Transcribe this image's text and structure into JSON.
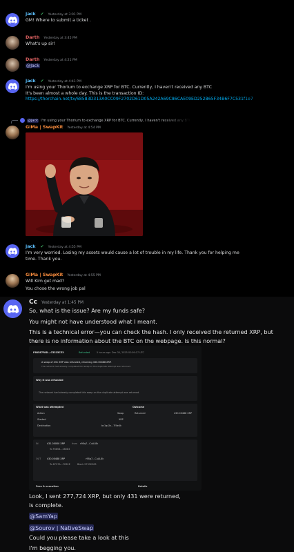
{
  "messages": {
    "m1": {
      "author": "jack",
      "timestamp": "Yesterday at 3:01 PM",
      "text": "GM!  Where to submit a ticket ."
    },
    "m2": {
      "author": "Darth",
      "timestamp": "Yesterday at 3:45 PM",
      "text": "What's up sir!"
    },
    "m3": {
      "author": "Darth",
      "timestamp": "Yesterday at 4:21 PM",
      "mention": "@Jack"
    },
    "m4": {
      "author": "jack",
      "timestamp": "Yesterday at 4:41 PM",
      "line1": "I'm using your Thorium to exchange XRP for BTC. Currently, I haven't received any BTC",
      "line2": "It's been almost a whole day. This is the transaction ID:",
      "link": "https://thorchain.net/tx/68583D313A0CC09F2702D61D05A242A69C86CAE09ED252B65F34B6F7C531f1e7"
    },
    "m5": {
      "reply_author": "@jack",
      "reply_text": "I'm using your Thorium to exchange XRP for BTC. Currently, I haven't received any BTC",
      "author": "GiMa | SwapKit",
      "timestamp": "Yesterday at 4:54 PM"
    },
    "m6": {
      "author": "jack",
      "timestamp": "Yesterday at 4:55 PM",
      "line1": "I'm very worried. Losing my assets would cause a lot of trouble in my life. Thank you for helping me",
      "line2": "time. Thank you."
    },
    "m7": {
      "author": "GiMa | SwapKit",
      "timestamp": "Yesterday at 4:55 PM",
      "line1": "Will Kim get mad?",
      "line2": "You chose the wrong job pal"
    },
    "m8": {
      "author": "Cc",
      "timestamp": "Yesterday at 1:45 PM",
      "lines": [
        "So, what is the issue? Are my funds safe?",
        "You might not have understood what I meant.",
        "This is a technical error—you can check the hash. I only received the returned XRP, but",
        "there is no information about the BTC on the webpage. Is this normal?"
      ],
      "after": [
        "Look, I sent 277,724 XRP, but only 431 were returned, ",
        "is complete."
      ],
      "mentions": [
        "@SamYap",
        "@Sourov | NativeSwap"
      ],
      "closing": [
        "Could you please take a look at this",
        "I'm begging you."
      ]
    }
  },
  "receipt": {
    "tx_short": "F68587FAD...C5315CE3",
    "status": "Refunded",
    "time": "5 hours ago",
    "date": "Dec 30, 2025 02:09:17 UTC",
    "swap_title": "A swap of 431 XRP was refunded, returning 430.00488 XRP.",
    "swap_sub": "The network had already completed this swap on the duplicate attempt was returned.",
    "why_title": "Why it was refunded",
    "why_text": "The network had already completed this swap on the duplicate attempt was returned.",
    "attempted_title": "What was attempted",
    "outcome_title": "Outcome",
    "rows": [
      {
        "label": "Action",
        "value": "Swap"
      },
      {
        "label": "Started",
        "value": "XRP"
      },
      {
        "label": "Destination",
        "value": "bc1qz2z...7f4e4k"
      }
    ],
    "outcome_label": "Returned",
    "outcome_value": "430.00488 XRP",
    "in_amount": "431.00000 XRP",
    "in_from": "from",
    "in_addr": "r9Bq7...CuAL8k",
    "in_to": "To F6858...28083",
    "out_amount": "430.00488 XRP",
    "out_addr": "r9Bq7...CuAL8k",
    "out_to": "To 8797A...FCB2E",
    "out_block": "Block 27932563",
    "fees_label": "Fees & execution",
    "details_label": "Details",
    "in_label": "IN",
    "out_label": "OUT"
  }
}
